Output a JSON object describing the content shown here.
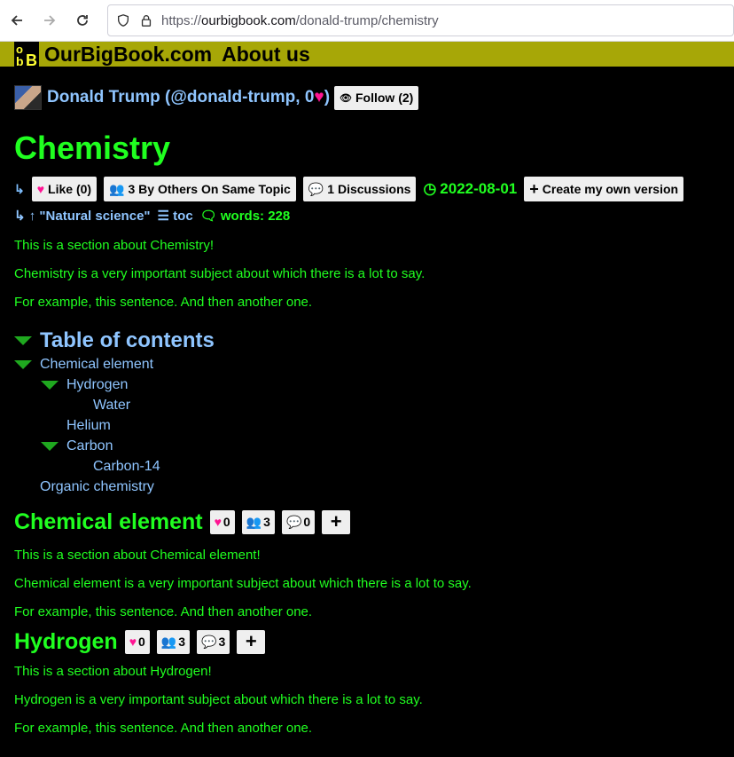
{
  "browser": {
    "url_scheme": "https://",
    "url_host": "ourbigbook.com",
    "url_path": "/donald-trump/chemistry"
  },
  "site": {
    "brand": "OurBigBook.com",
    "about": "About us",
    "bar_color": "#a7a707"
  },
  "author": {
    "name": "Donald Trump (@donald-trump, 0",
    "name_suffix": ")",
    "follow_label": "Follow (2)"
  },
  "article": {
    "title": "Chemistry",
    "like_label": "Like (0)",
    "others_label": "3 By Others On Same Topic",
    "discussions_label": "1 Discussions",
    "date": "2022-08-01",
    "create_label": "Create my own version",
    "parent_label": "\"Natural science\"",
    "toc_label": "toc",
    "words_label": "words: 228",
    "paragraphs": [
      "This is a section about Chemistry!",
      "Chemistry is a very important subject about which there is a lot to say.",
      "For example, this sentence. And then another one."
    ]
  },
  "toc": {
    "title": "Table of contents",
    "items": [
      {
        "label": "Chemical element"
      },
      {
        "label": "Hydrogen"
      },
      {
        "label": "Water"
      },
      {
        "label": "Helium"
      },
      {
        "label": "Carbon"
      },
      {
        "label": "Carbon-14"
      },
      {
        "label": "Organic chemistry"
      }
    ]
  },
  "sections": [
    {
      "title": "Chemical element",
      "likes": "0",
      "others": "3",
      "discussions": "0",
      "paragraphs": [
        "This is a section about Chemical element!",
        "Chemical element is a very important subject about which there is a lot to say.",
        "For example, this sentence. And then another one."
      ]
    },
    {
      "title": "Hydrogen",
      "likes": "0",
      "others": "3",
      "discussions": "3",
      "paragraphs": [
        "This is a section about Hydrogen!",
        "Hydrogen is a very important subject about which there is a lot to say.",
        "For example, this sentence. And then another one."
      ]
    }
  ],
  "colors": {
    "heading_green": "#20ff20",
    "link_blue": "#8fc5ff",
    "heart_pink": "#ff1493"
  }
}
